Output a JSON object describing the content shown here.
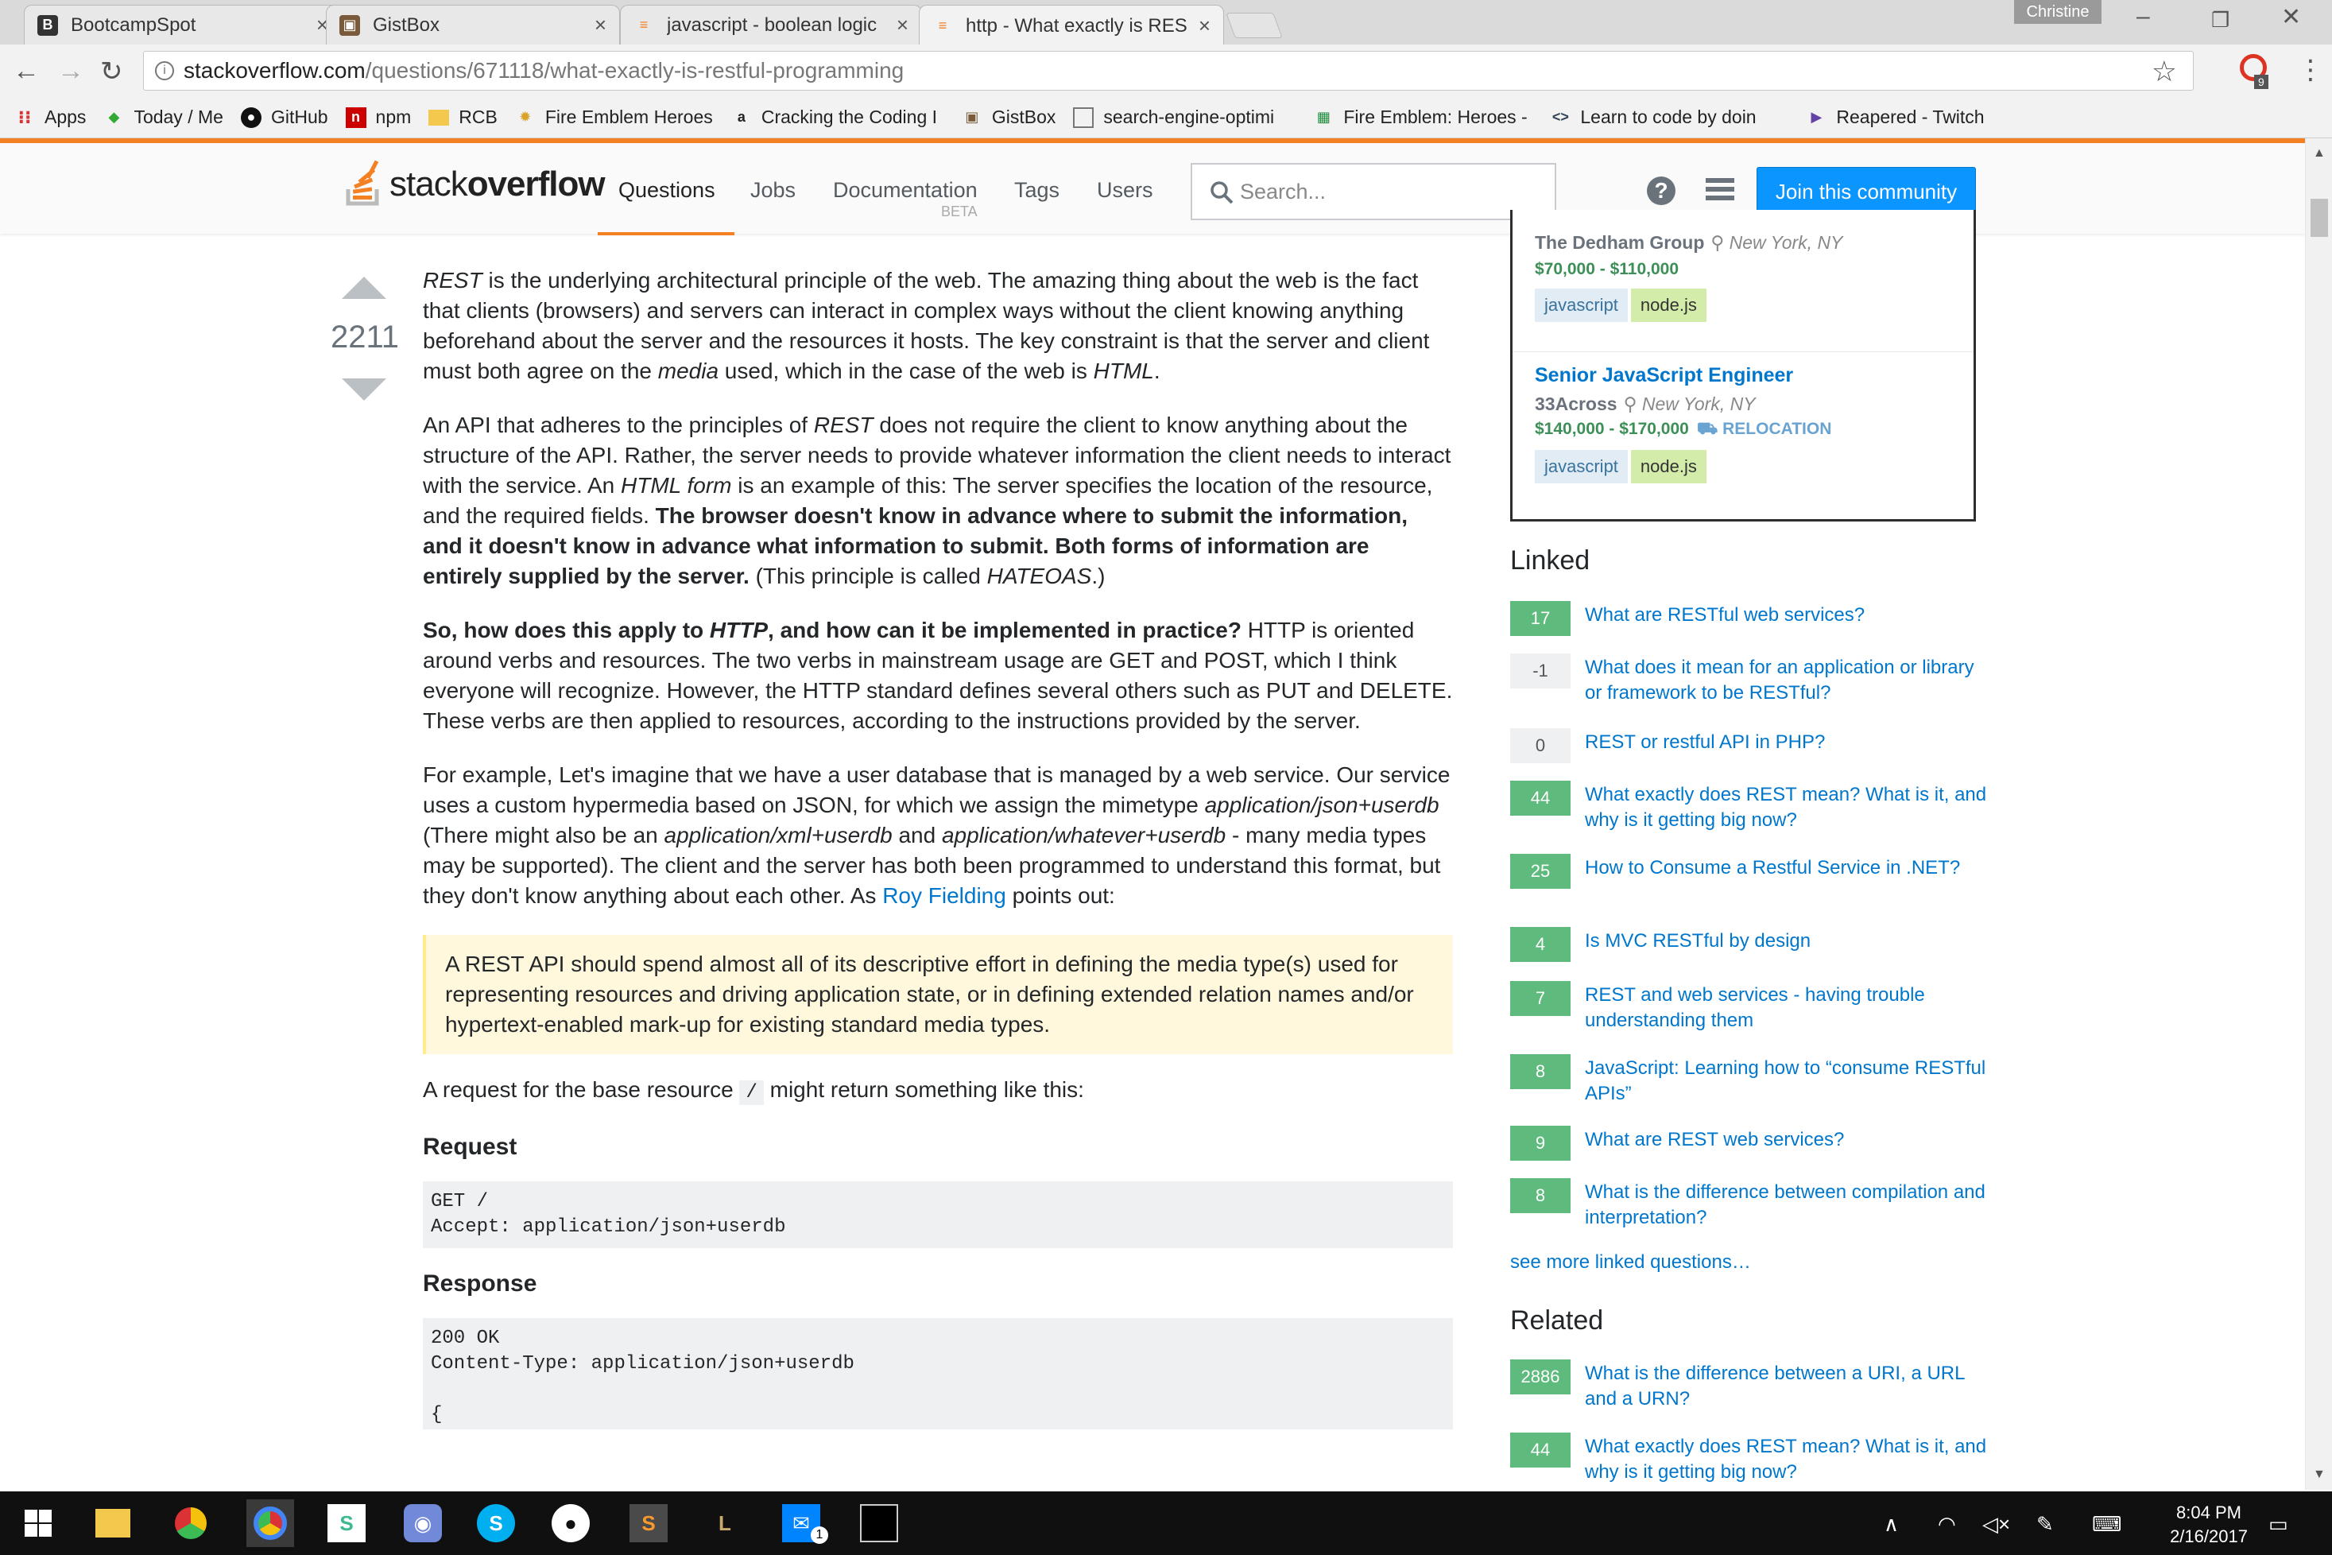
{
  "browser": {
    "tabs": [
      {
        "title": "BootcampSpot",
        "favicon": "B"
      },
      {
        "title": "GistBox",
        "favicon": "G"
      },
      {
        "title": "javascript - boolean logic",
        "favicon": "so"
      },
      {
        "title": "http - What exactly is RES",
        "favicon": "so"
      }
    ],
    "user": "Christine",
    "url_host": "stackoverflow.com",
    "url_path": "/questions/671118/what-exactly-is-restful-programming",
    "ext_badge": "9",
    "bookmarks": [
      {
        "label": "Apps",
        "icon": "apps-grid-icon"
      },
      {
        "label": "Today / Me",
        "icon": "diamond-icon"
      },
      {
        "label": "GitHub",
        "icon": "github-icon"
      },
      {
        "label": "npm",
        "icon": "npm-icon"
      },
      {
        "label": "RCB",
        "icon": "folder-icon"
      },
      {
        "label": "Fire Emblem Heroes W",
        "icon": "emblem-icon"
      },
      {
        "label": "Cracking the Coding I",
        "icon": "amazon-icon"
      },
      {
        "label": "GistBox",
        "icon": "gistbox-icon"
      },
      {
        "label": "search-engine-optimi",
        "icon": "page-icon"
      },
      {
        "label": "Fire Emblem: Heroes -",
        "icon": "sheet-icon"
      },
      {
        "label": "Learn to code by doin",
        "icon": "code-icon"
      },
      {
        "label": "Reapered - Twitch",
        "icon": "twitch-icon"
      }
    ]
  },
  "header": {
    "logo_stack": "stack",
    "logo_overflow": "overflow",
    "nav": [
      "Questions",
      "Jobs",
      "Documentation",
      "Tags",
      "Users"
    ],
    "beta": "BETA",
    "search_placeholder": "Search...",
    "help": "?",
    "join": "Join this community"
  },
  "vote": {
    "count": "2211"
  },
  "post": {
    "p1": [
      {
        "t": "REST",
        "i": true
      },
      {
        "t": " is the underlying architectural principle of the web. The amazing thing about the web is the fact that clients (browsers) and servers can interact in complex ways without the client knowing anything beforehand about the server and the resources it hosts. The key constraint is that the server and client must both agree on the "
      },
      {
        "t": "media",
        "i": true
      },
      {
        "t": " used, which in the case of the web is "
      },
      {
        "t": "HTML",
        "i": true
      },
      {
        "t": "."
      }
    ],
    "p2": [
      {
        "t": "An API that adheres to the principles of "
      },
      {
        "t": "REST",
        "i": true
      },
      {
        "t": " does not require the client to know anything about the structure of the API. Rather, the server needs to provide whatever information the client needs to interact with the service. An "
      },
      {
        "t": "HTML form",
        "i": true
      },
      {
        "t": " is an example of this: The server specifies the location of the resource, and the required fields. "
      },
      {
        "t": "The browser doesn't know in advance where to submit the information, and it doesn't know in advance what information to submit. Both forms of information are entirely supplied by the server.",
        "b": true
      },
      {
        "t": " (This principle is called "
      },
      {
        "t": "HATEOAS",
        "i": true
      },
      {
        "t": ".)"
      }
    ],
    "p3": [
      {
        "t": "So, how does this apply to ",
        "b": true
      },
      {
        "t": "HTTP",
        "b": true,
        "i": true
      },
      {
        "t": ", and how can it be implemented in practice?",
        "b": true
      },
      {
        "t": " HTTP is oriented around verbs and resources. The two verbs in mainstream usage are GET and POST, which I think everyone will recognize. However, the HTTP standard defines several others such as PUT and DELETE. These verbs are then applied to resources, according to the instructions provided by the server."
      }
    ],
    "p4": [
      {
        "t": "For example, Let's imagine that we have a user database that is managed by a web service. Our service uses a custom hypermedia based on JSON, for which we assign the mimetype "
      },
      {
        "t": "application/json+userdb",
        "i": true
      },
      {
        "t": " (There might also be an "
      },
      {
        "t": "application/xml+userdb",
        "i": true
      },
      {
        "t": " and "
      },
      {
        "t": "application/whatever+userdb",
        "i": true
      },
      {
        "t": " - many media types may be supported). The client and the server has both been programmed to understand this format, but they don't know anything about each other. As "
      },
      {
        "t": "Roy Fielding",
        "a": true
      },
      {
        "t": " points out:"
      }
    ],
    "quote": "A REST API should spend almost all of its descriptive effort in defining the media type(s) used for representing resources and driving application state, or in defining extended relation names and/or hypertext-enabled mark-up for existing standard media types.",
    "p5_before": "A request for the base resource ",
    "p5_code": "/",
    "p5_after": " might return something like this:",
    "request_h": "Request",
    "request_code": "GET /\nAccept: application/json+userdb",
    "response_h": "Response",
    "response_code": "200 OK\nContent-Type: application/json+userdb\n\n{"
  },
  "jobs": [
    {
      "title": "",
      "company": "The Dedham Group",
      "location": "New York, NY",
      "salary": "$70,000 - $110,000",
      "relocation": "",
      "tags": [
        "javascript",
        "node.js"
      ]
    },
    {
      "title": "Senior JavaScript Engineer",
      "company": "33Across",
      "location": "New York, NY",
      "salary": "$140,000 - $170,000",
      "relocation": "RELOCATION",
      "tags": [
        "javascript",
        "node.js"
      ]
    }
  ],
  "linked": {
    "heading": "Linked",
    "items": [
      {
        "score": "17",
        "title": "What are RESTful web services?"
      },
      {
        "score": "-1",
        "title": "What does it mean for an application or library or framework to be RESTful?"
      },
      {
        "score": "0",
        "title": "REST or restful API in PHP?"
      },
      {
        "score": "44",
        "title": "What exactly does REST mean? What is it, and why is it getting big now?"
      },
      {
        "score": "25",
        "title": "How to Consume a Restful Service in .NET?"
      },
      {
        "score": "4",
        "title": "Is MVC RESTful by design"
      },
      {
        "score": "7",
        "title": "REST and web services - having trouble understanding them"
      },
      {
        "score": "8",
        "title": "JavaScript: Learning how to “consume RESTful APIs”"
      },
      {
        "score": "9",
        "title": "What are REST web services?"
      },
      {
        "score": "8",
        "title": "What is the difference between compilation and interpretation?"
      }
    ],
    "more": "see more linked questions…"
  },
  "related": {
    "heading": "Related",
    "items": [
      {
        "score": "2886",
        "title": "What is the difference between a URI, a URL and a URN?"
      },
      {
        "score": "44",
        "title": "What exactly does REST mean? What is it, and why is it getting big now?"
      }
    ]
  },
  "taskbar": {
    "time": "8:04 PM",
    "date": "2/16/2017",
    "messenger_badge": "1"
  }
}
